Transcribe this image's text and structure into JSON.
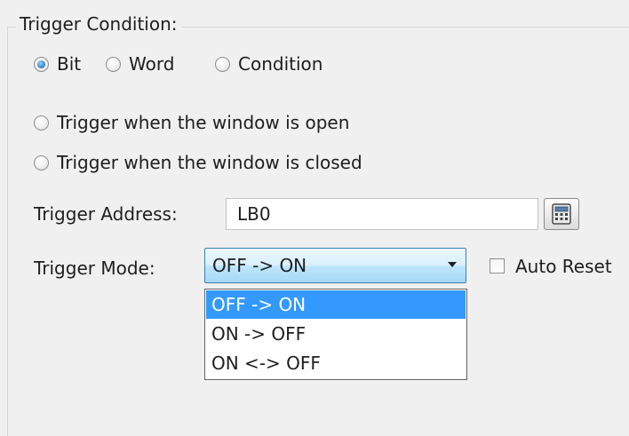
{
  "group_title": "Trigger Condition:",
  "trigger_type": {
    "options": [
      "Bit",
      "Word",
      "Condition"
    ],
    "selected": "Bit"
  },
  "window_triggers": [
    "Trigger when the window is open",
    "Trigger when the window is closed"
  ],
  "trigger_address": {
    "label": "Trigger Address:",
    "value": "LB0",
    "button_icon": "calculator-icon"
  },
  "trigger_mode": {
    "label": "Trigger Mode:",
    "selected": "OFF -> ON",
    "options": [
      "OFF -> ON",
      "ON -> OFF",
      "ON <-> OFF"
    ],
    "highlighted": "OFF -> ON"
  },
  "auto_reset": {
    "label": "Auto Reset",
    "checked": false
  },
  "colors": {
    "accent": "#3399ff",
    "radio_checked": "#3d8ed3",
    "select_border": "#3c7fb1"
  }
}
